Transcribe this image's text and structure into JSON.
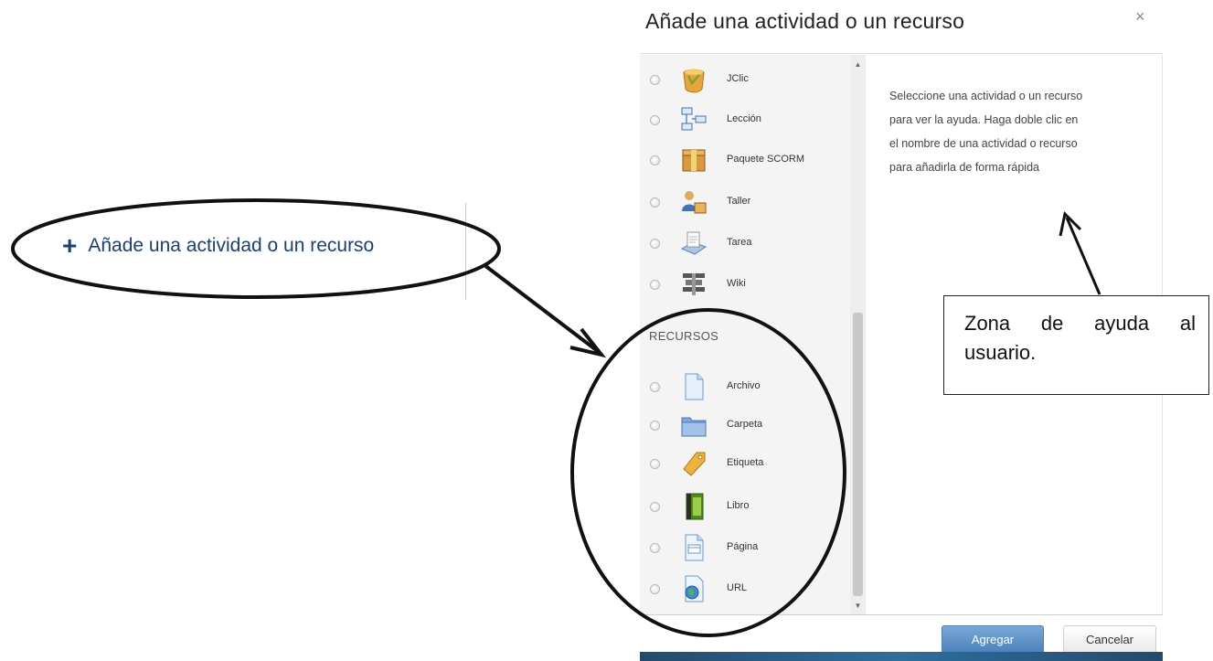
{
  "add_link": {
    "label": "Añade una actividad o un recurso",
    "plus_glyph": "+"
  },
  "dialog": {
    "title": "Añade una actividad o un recurso",
    "close_glyph": "×",
    "activities": [
      {
        "label": "JClic",
        "icon": "jclic-icon"
      },
      {
        "label": "Lección",
        "icon": "lesson-icon"
      },
      {
        "label": "Paquete SCORM",
        "icon": "scorm-package-icon"
      },
      {
        "label": "Taller",
        "icon": "workshop-icon"
      },
      {
        "label": "Tarea",
        "icon": "assignment-icon"
      },
      {
        "label": "Wiki",
        "icon": "wiki-icon"
      }
    ],
    "resources_heading": "RECURSOS",
    "resources": [
      {
        "label": "Archivo",
        "icon": "file-icon"
      },
      {
        "label": "Carpeta",
        "icon": "folder-icon"
      },
      {
        "label": "Etiqueta",
        "icon": "label-tag-icon"
      },
      {
        "label": "Libro",
        "icon": "book-icon"
      },
      {
        "label": "Página",
        "icon": "page-icon"
      },
      {
        "label": "URL",
        "icon": "url-icon"
      }
    ],
    "help_lines": [
      "Seleccione una actividad o un recurso",
      "para ver la ayuda. Haga doble clic en",
      "el nombre de una actividad o recurso",
      "para añadirla de forma rápida"
    ],
    "add_button": "Agregar",
    "cancel_button": "Cancelar"
  },
  "annotation": {
    "callout_text": "Zona de ayuda al usuario."
  },
  "colors": {
    "link_blue": "#1b3f77",
    "primary_button": "#4a7fb9",
    "bottom_bar": "#2f6e9e"
  }
}
